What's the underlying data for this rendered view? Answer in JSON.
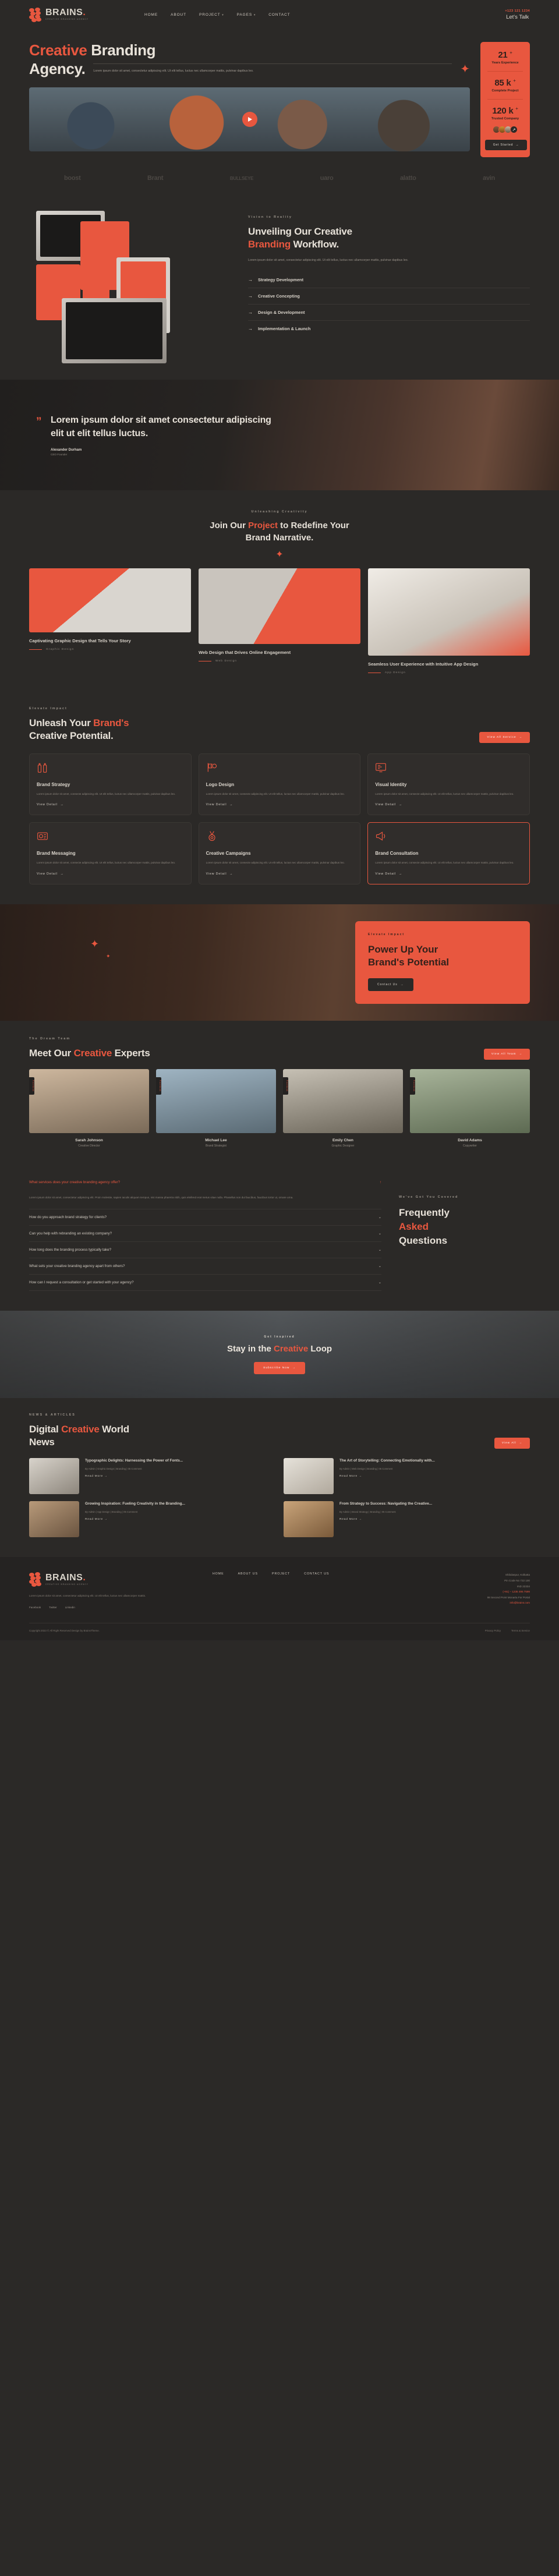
{
  "brand": {
    "name": "BRAINS",
    "dot": ".",
    "tagline": "CREATIVE BRANDING AGENCY",
    "accent": "#e8573f",
    "background": "#2b2927"
  },
  "header": {
    "nav": [
      {
        "label": "HOME",
        "caret": ""
      },
      {
        "label": "ABOUT",
        "caret": ""
      },
      {
        "label": "PROJECT",
        "caret": "▾"
      },
      {
        "label": "PAGES",
        "caret": "▾"
      },
      {
        "label": "CONTACT",
        "caret": ""
      }
    ],
    "phone": "+123 121 1234",
    "cta": "Let's Talk"
  },
  "hero": {
    "title_accent": "Creative",
    "title_rest": " Branding",
    "title_line2": "Agency.",
    "description": "Lorem ipsum dolor sit amet, consectetur adipiscing elit. Ut elit tellus, luctus nec ullamcorper mattis, pulvinar dapibus leo.",
    "stats": [
      {
        "value": "21",
        "suffix": "+",
        "label": "Years Experience"
      },
      {
        "value": "85 k",
        "suffix": "+",
        "label": "Complete Project"
      },
      {
        "value": "120 k",
        "suffix": "+",
        "label": "Trusted Company"
      }
    ],
    "stat_button": "Get Started",
    "avatar_more": "↗"
  },
  "brands": [
    "boost",
    "Brant",
    "BULLSEYE",
    "uaro",
    "alatto",
    "avin"
  ],
  "workflow": {
    "eyebrow": "Vision to Reality",
    "title_1": "Unveiling Our Creative",
    "title_accent": "Branding",
    "title_2": " Workflow.",
    "description": "Lorem ipsum dolor sit amet, consectetur adipiscing elit. Ut elit tellus, luctus nec ullamcorper mattis, pulvinar dapibus leo.",
    "items": [
      "Strategy Development",
      "Creative Concepting",
      "Design & Development",
      "Implementation & Launch"
    ]
  },
  "quote": {
    "mark": "”",
    "text": "Lorem ipsum dolor sit amet consectetur adipiscing elit ut elit tellus luctus.",
    "author": "Alexander Durham",
    "role": "CEO Founder"
  },
  "projects": {
    "eyebrow": "Unleashing Creativity",
    "title_1": "Join Our ",
    "title_accent": "Project",
    "title_2": " to Redefine Your",
    "title_line2": "Brand Narrative.",
    "cards": [
      {
        "title": "Captivating Graphic Design that Tells Your Story",
        "tag": "Graphic Design"
      },
      {
        "title": "Web Design that Drives Online Engagement",
        "tag": "Web Design"
      },
      {
        "title": "Seamless User Experience with Intuitive App Design",
        "tag": "App Design"
      }
    ]
  },
  "services": {
    "eyebrow": "Elevate Impact",
    "title_1": "Unleash Your ",
    "title_accent": "Brand's",
    "title_line2": "Creative Potential.",
    "button": "View All Service",
    "link_label": "View Detail",
    "cards": [
      {
        "icon": "bottles-icon",
        "title": "Brand Strategy",
        "desc": "Lorem ipsum dolor sit amet, consecte adipiscing elit. Ut elit tellus, luctus nec ullamcorper mattis, pulvinar dapibus leo.",
        "highlight": false
      },
      {
        "icon": "flag-icon",
        "title": "Logo Design",
        "desc": "Lorem ipsum dolor sit amet, consecte adipiscing elit. Ut elit tellus, luctus nec ullamcorper mattis, pulvinar dapibus leo.",
        "highlight": false
      },
      {
        "icon": "monitor-icon",
        "title": "Visual Identity",
        "desc": "Lorem ipsum dolor sit amet, consecte adipiscing elit. Ut elit tellus, luctus nec ullamcorper mattis, pulvinar dapibus leo.",
        "highlight": false
      },
      {
        "icon": "camera-icon",
        "title": "Brand Messaging",
        "desc": "Lorem ipsum dolor sit amet, consecte adipiscing elit. Ut elit tellus, luctus nec ullamcorper mattis, pulvinar dapibus leo.",
        "highlight": false
      },
      {
        "icon": "medal-icon",
        "title": "Creative Campaigns",
        "desc": "Lorem ipsum dolor sit amet, consecte adipiscing elit. Ut elit tellus, luctus nec ullamcorper mattis, pulvinar dapibus leo.",
        "highlight": false
      },
      {
        "icon": "megaphone-icon",
        "title": "Brand Consultation",
        "desc": "Lorem ipsum dolor sit amet, consecte adipiscing elit. Ut elit tellus, luctus nec ullamcorper mattis, pulvinar dapibus leo.",
        "highlight": true
      }
    ]
  },
  "cta": {
    "eyebrow": "Elevate Impact",
    "title_1": "Power Up Your",
    "title_2": "Brand's Potential",
    "button": "Contact Us"
  },
  "team": {
    "eyebrow": "The Dream Team",
    "title_1": "Meet Our ",
    "title_accent": "Creative",
    "title_2": " Experts",
    "button": "View All Team",
    "social": "Facebook",
    "members": [
      {
        "name": "Sarah Johnson",
        "role": "Creative Director"
      },
      {
        "name": "Michael Lee",
        "role": "Brand Strategist"
      },
      {
        "name": "Emily Chen",
        "role": "Graphic Designer"
      },
      {
        "name": "David Adams",
        "role": "Copywriter"
      }
    ]
  },
  "faq": {
    "eyebrow": "We've Got You Covered",
    "title_1": "Frequently",
    "title_accent": "Asked",
    "title_2": "Questions",
    "open_answer": "Lorem ipsum dolor sit amet, consectetur adipiscing elit. Proin molestie, sapien iaculis aliquam tempus, nisi massa pharetra nibh, quis eleifend erat metus vitae nulla. Phasellus non dui faucibus, faucibus tortor ut, ornare urna.",
    "items": [
      {
        "q": "What services does your creative branding agency offer?",
        "open": true,
        "icon": "↑"
      },
      {
        "q": "How do you approach brand strategy for clients?",
        "open": false,
        "icon": "⌄"
      },
      {
        "q": "Can you help with rebranding an existing company?",
        "open": false,
        "icon": "⌄"
      },
      {
        "q": "How long does the branding process typically take?",
        "open": false,
        "icon": "⌄"
      },
      {
        "q": "What sets your creative branding agency apart from others?",
        "open": false,
        "icon": "⌄"
      },
      {
        "q": "How can I request a consultation or get started with your agency?",
        "open": false,
        "icon": "⌄"
      }
    ]
  },
  "newsletter": {
    "eyebrow": "Get Inspired",
    "title_1": "Stay in the ",
    "title_accent": "Creative",
    "title_2": " Loop",
    "button": "Subscribe Now"
  },
  "blog": {
    "eyebrow": "NEWS & ARTICLES",
    "title_1": "Digital ",
    "title_accent": "Creative",
    "title_2": " World",
    "title_line2": "News",
    "button": "View All",
    "link_label": "Read More",
    "posts": [
      {
        "title": "Typographic Delights: Harnessing the Power of Fonts...",
        "meta": "By Admin  |  Graphic Design  |  Branding  |  05 Comment"
      },
      {
        "title": "The Art of Storytelling: Connecting Emotionally with...",
        "meta": "By Admin  |  Web Design  |  Branding  |  05 Comment"
      },
      {
        "title": "Growing Inspiration: Fueling Creativity in the Branding...",
        "meta": "By Admin  |  App Design  |  Branding  |  05 Comment"
      },
      {
        "title": "From Strategy to Success: Navigating the Creative...",
        "meta": "By Admin  |  Brand Strategy  |  Branding  |  05 Comment"
      }
    ]
  },
  "footer": {
    "description": "Lorem ipsum dolor sit amet, consectetur adipiscing elit. Ut elit tellus, luctus nec ullamcorper mattis.",
    "social": [
      "Facebook",
      "Twitter",
      "Linkedin"
    ],
    "nav": [
      "HOME",
      "ABOUT US",
      "PROJECT",
      "CONTACT US"
    ],
    "contact": [
      "Shibdaspur, Kolkatta",
      "Pin Code No 722 100",
      "IND 22334",
      "(+91) – 1235 495 7599",
      "98 Second Point Monarta For Portal",
      "info@brains.com"
    ],
    "copyright": "Copyright 2023 © All Right Reserved Design by BrainsTheme.",
    "links": [
      "Privacy Policy",
      "Terms & Service"
    ]
  }
}
